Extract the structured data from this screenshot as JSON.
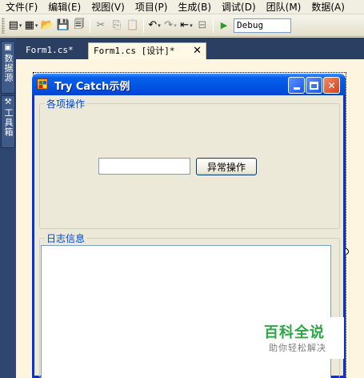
{
  "menu": [
    "文件(F)",
    "编辑(E)",
    "视图(V)",
    "项目(P)",
    "生成(B)",
    "调试(D)",
    "团队(M)",
    "数据(A)"
  ],
  "toolbar": {
    "icons": [
      {
        "name": "add-new-item-icon",
        "glyph": "▤",
        "dropdown": true,
        "disabled": false
      },
      {
        "name": "add-item-icon",
        "glyph": "▦",
        "dropdown": true,
        "disabled": false
      },
      {
        "name": "open-file-icon",
        "glyph": "📂",
        "dropdown": false,
        "disabled": false
      },
      {
        "name": "save-icon",
        "glyph": "💾",
        "dropdown": false,
        "disabled": false
      },
      {
        "name": "save-all-icon",
        "glyph": "🗐",
        "dropdown": false,
        "disabled": false
      },
      {
        "name": "cut-icon",
        "glyph": "✂",
        "dropdown": false,
        "disabled": true
      },
      {
        "name": "copy-icon",
        "glyph": "⎘",
        "dropdown": false,
        "disabled": true
      },
      {
        "name": "paste-icon",
        "glyph": "📋",
        "dropdown": false,
        "disabled": true
      },
      {
        "name": "undo-icon",
        "glyph": "↶",
        "dropdown": true,
        "disabled": false
      },
      {
        "name": "redo-icon",
        "glyph": "↷",
        "dropdown": true,
        "disabled": true
      },
      {
        "name": "navigate-icon",
        "glyph": "⇤",
        "dropdown": true,
        "disabled": false
      },
      {
        "name": "find-icon",
        "glyph": "⊟",
        "dropdown": false,
        "disabled": true
      },
      {
        "name": "start-debug-icon",
        "glyph": "▶",
        "dropdown": false,
        "disabled": false
      }
    ],
    "config": "Debug"
  },
  "side_tabs": [
    {
      "icon": "data-source-icon",
      "label": "数据源"
    },
    {
      "icon": "toolbox-icon",
      "label": "工具箱"
    }
  ],
  "doc_tabs": {
    "inactive": "Form1.cs*",
    "active": "Form1.cs [设计]*",
    "close_glyph": "✕"
  },
  "form": {
    "title": "Try Catch示例",
    "group_ops": "各项操作",
    "button_label": "异常操作",
    "textbox_value": "",
    "group_log": "日志信息",
    "log_value": ""
  },
  "watermark": {
    "title": "百科全说",
    "subtitle": "助你轻松解决"
  },
  "colors": {
    "titlebar": "#0055e5",
    "group_title": "#0046d5",
    "dark_frame": "#2b3f63",
    "watermark": "#2aa843"
  }
}
